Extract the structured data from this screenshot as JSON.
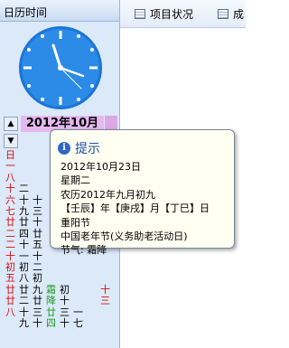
{
  "panel": {
    "title": "日历时间"
  },
  "calendar": {
    "header": "2012年10月",
    "nav_up": "▲",
    "nav_down": "▼",
    "cols": [
      {
        "lines": [
          "日",
          "一",
          "八",
          "十",
          "六",
          "七",
          "廿",
          "二",
          "二",
          "十",
          "初",
          "五",
          "廿",
          "廿",
          "八"
        ],
        "color": "wk-red"
      },
      {
        "lines": [
          "",
          "",
          "",
          "二",
          "十",
          "九",
          "廿",
          "四",
          "十",
          "一",
          "初",
          "八",
          "廿",
          "二",
          "十",
          "九"
        ],
        "color": ""
      },
      {
        "lines": [
          "",
          "",
          "",
          "",
          "十",
          "三",
          "十",
          "廿",
          "五",
          "十",
          "二",
          "初",
          "九",
          "廿",
          "三",
          "十"
        ],
        "color": ""
      },
      {
        "lines": [
          "",
          "",
          "",
          "",
          "",
          "",
          "",
          "",
          "",
          "",
          "",
          "",
          "霜",
          "降",
          "廿",
          "四"
        ],
        "color": "wk-green"
      },
      {
        "lines": [
          "",
          "",
          "",
          "",
          "",
          "",
          "",
          "",
          "",
          "",
          "",
          "",
          "初",
          "十",
          "三",
          "十"
        ],
        "color": ""
      },
      {
        "lines": [
          "",
          "",
          "",
          "",
          "",
          "",
          "",
          "",
          "",
          "",
          "",
          "",
          "",
          "",
          "一",
          "七"
        ],
        "color": ""
      },
      {
        "lines": [
          "",
          "",
          "",
          "",
          "",
          "",
          "",
          "",
          "",
          "",
          "",
          "",
          "",
          "",
          "",
          ""
        ],
        "color": ""
      },
      {
        "lines": [
          "",
          "",
          "",
          "",
          "",
          "",
          "",
          "",
          "",
          "",
          "",
          "",
          "十",
          "三",
          "",
          ""
        ],
        "color": "wk-red"
      }
    ]
  },
  "tabs": [
    {
      "label": "项目状况"
    },
    {
      "label": "成"
    }
  ],
  "tooltip": {
    "title": "提示",
    "lines": [
      "2012年10月23日",
      "星期二",
      "农历2012年九月初九",
      "【壬辰】年【庚戌】月【丁巳】日",
      "重阳节",
      "中国老年节(义务助老活动日)",
      "节气: 霜降"
    ]
  }
}
